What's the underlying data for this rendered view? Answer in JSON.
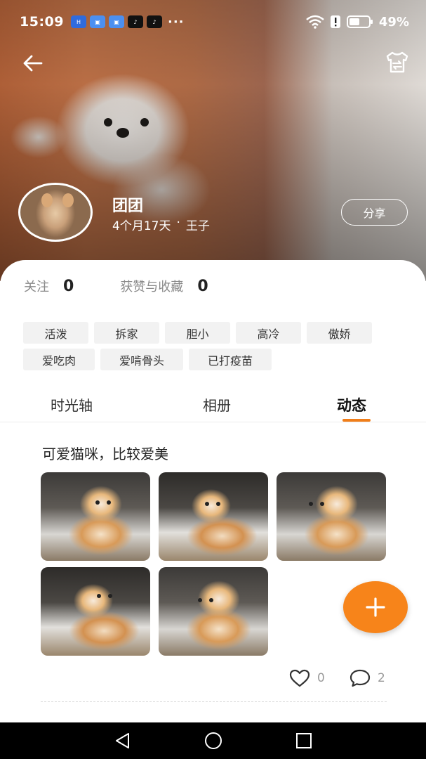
{
  "status_bar": {
    "time": "15:09",
    "app_icons": [
      "honor-icon",
      "app-icon",
      "app-icon",
      "tiktok-icon",
      "tiktok-icon"
    ],
    "more_indicator": "···",
    "battery_percent": "49%"
  },
  "profile": {
    "name": "团团",
    "age": "4个月17天",
    "separator": "·",
    "breed": "王子",
    "share_label": "分享"
  },
  "stats": {
    "following_label": "关注",
    "following_count": "0",
    "likes_label": "获赞与收藏",
    "likes_count": "0"
  },
  "tags": [
    "活泼",
    "拆家",
    "胆小",
    "高冷",
    "傲娇",
    "爱吃肉",
    "爱啃骨头",
    "已打疫苗"
  ],
  "tabs": [
    {
      "label": "时光轴",
      "active": false
    },
    {
      "label": "相册",
      "active": false
    },
    {
      "label": "动态",
      "active": true
    }
  ],
  "post": {
    "text": "可爱猫咪，比较爱美",
    "photo_count": 5,
    "likes": "0",
    "comments": "2"
  },
  "colors": {
    "accent": "#f7841a",
    "tag_bg": "#f2f2f2",
    "stat_label": "#8a8a8a"
  }
}
